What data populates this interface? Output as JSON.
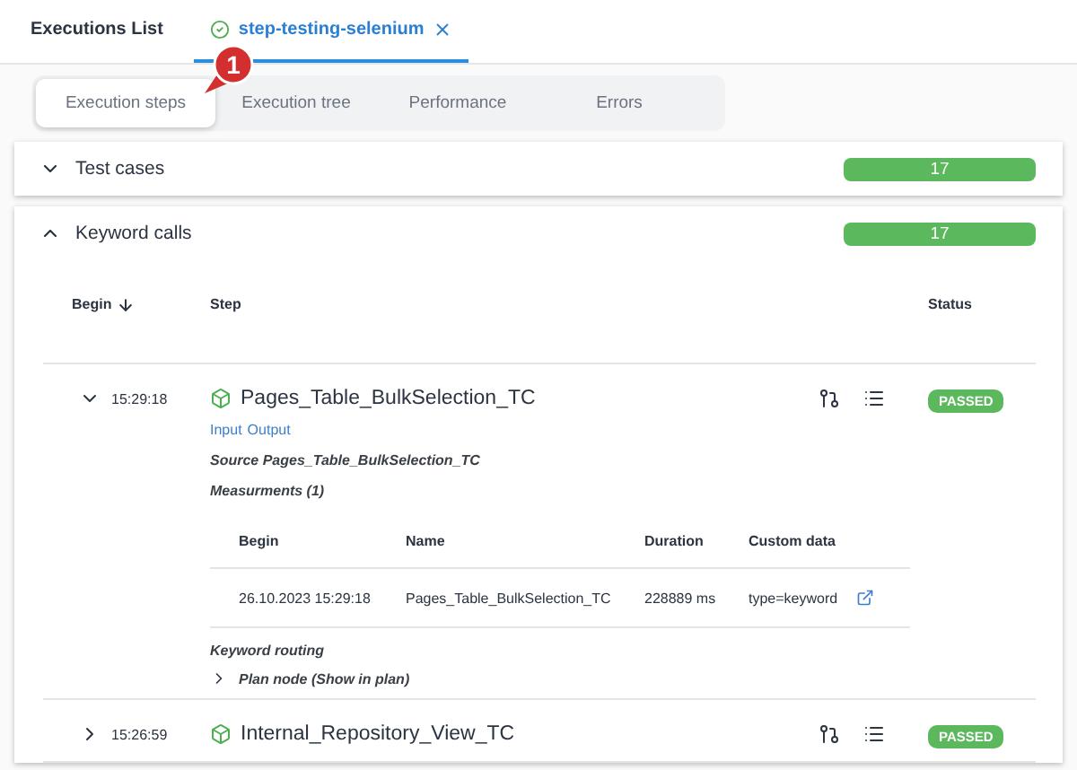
{
  "tabs": [
    {
      "label": "Executions List",
      "selected": false,
      "kind": "plain",
      "closable": false
    },
    {
      "label": "step-testing-selenium",
      "selected": true,
      "kind": "execution",
      "closable": true
    }
  ],
  "annotation": {
    "label": "1"
  },
  "view_tabs": [
    {
      "label": "Execution steps",
      "selected": true
    },
    {
      "label": "Execution tree",
      "selected": false
    },
    {
      "label": "Performance",
      "selected": false
    },
    {
      "label": "Errors",
      "selected": false
    }
  ],
  "sections": [
    {
      "title": "Test cases",
      "expanded": false,
      "count": "17"
    },
    {
      "title": "Keyword calls",
      "expanded": true,
      "count": "17",
      "table": {
        "columns": [
          {
            "label": "Begin",
            "sorted": true
          },
          {
            "label": "Step",
            "sorted": false
          },
          {
            "label": "Status",
            "sorted": false
          }
        ],
        "rows": [
          {
            "expanded": true,
            "begin": "15:29:18",
            "name": "Pages_Table_BulkSelection_TC",
            "status": {
              "label": "PASSED",
              "kind": "passed"
            },
            "details": {
              "links": [
                "Input",
                "Output"
              ],
              "source": "Source Pages_Table_BulkSelection_TC",
              "measurements_title": "Measurments (1)",
              "measurements": {
                "columns": [
                  "Begin",
                  "Name",
                  "Duration",
                  "Custom data"
                ],
                "rows": [
                  [
                    "26.10.2023 15:29:18",
                    "Pages_Table_BulkSelection_TC",
                    "228889 ms",
                    "type=keyword"
                  ]
                ]
              },
              "routing_title": "Keyword routing",
              "plan_node": {
                "label": "Plan node (Show in plan)",
                "expanded": false
              }
            }
          },
          {
            "expanded": false,
            "begin": "15:26:59",
            "name": "Internal_Repository_View_TC",
            "status": {
              "label": "PASSED",
              "kind": "passed"
            }
          }
        ]
      }
    }
  ]
}
